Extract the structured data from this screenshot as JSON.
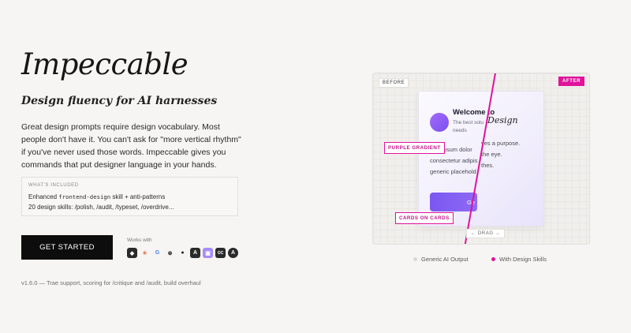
{
  "hero": {
    "title": "Impeccable",
    "subtitle": "Design fluency for AI harnesses",
    "description": "Great design prompts require design vocabulary. Most people don't have it. You can't ask for \"more vertical rhythm\" if you've never used those words. Impeccable gives you commands that put designer language in your hands."
  },
  "included": {
    "label": "WHAT'S INCLUDED",
    "line1_prefix": "Enhanced",
    "line1_code": "frontend-design",
    "line1_suffix": "skill + anti-patterns",
    "line2": "20 design skills: /polish, /audit, /typeset, /overdrive..."
  },
  "cta": {
    "label": "GET STARTED"
  },
  "works_with": {
    "label": "Works with",
    "logos": [
      "cursor-icon",
      "claude-icon",
      "google-icon",
      "openai-icon",
      "github-icon",
      "antigravity-icon",
      "kiro-icon",
      "opencode-icon",
      "trae-icon"
    ],
    "glyphs": [
      "◆",
      "✳",
      "G",
      "⊛",
      "●",
      "A",
      "▣",
      "OC",
      "A"
    ]
  },
  "version": "v1.6.0 — Trae support, scoring for /critique and /audit, build overhaul",
  "demo": {
    "before_tag": "BEFORE",
    "after_tag": "AFTER",
    "card_title": "Welcome to",
    "card_sub": "The best solu needs",
    "card_body_1": "rem ipsum dolor",
    "card_body_2": "consectetur adipis",
    "card_body_3": "generic placehold",
    "card_button": "Ge",
    "after_design": "Design",
    "after_line_1": "ves a purpose.",
    "after_line_2": "the eye.",
    "after_line_3": "thes.",
    "callout_gradient": "PURPLE GRADIENT",
    "callout_cards": "CARDS ON CARDS",
    "drag_label": "← DRAG →",
    "accent": "#e0139b"
  },
  "legend": {
    "generic": "Generic AI Output",
    "design": "With Design Skills",
    "generic_color": "#d9d7d3",
    "design_color": "#e0139b"
  }
}
